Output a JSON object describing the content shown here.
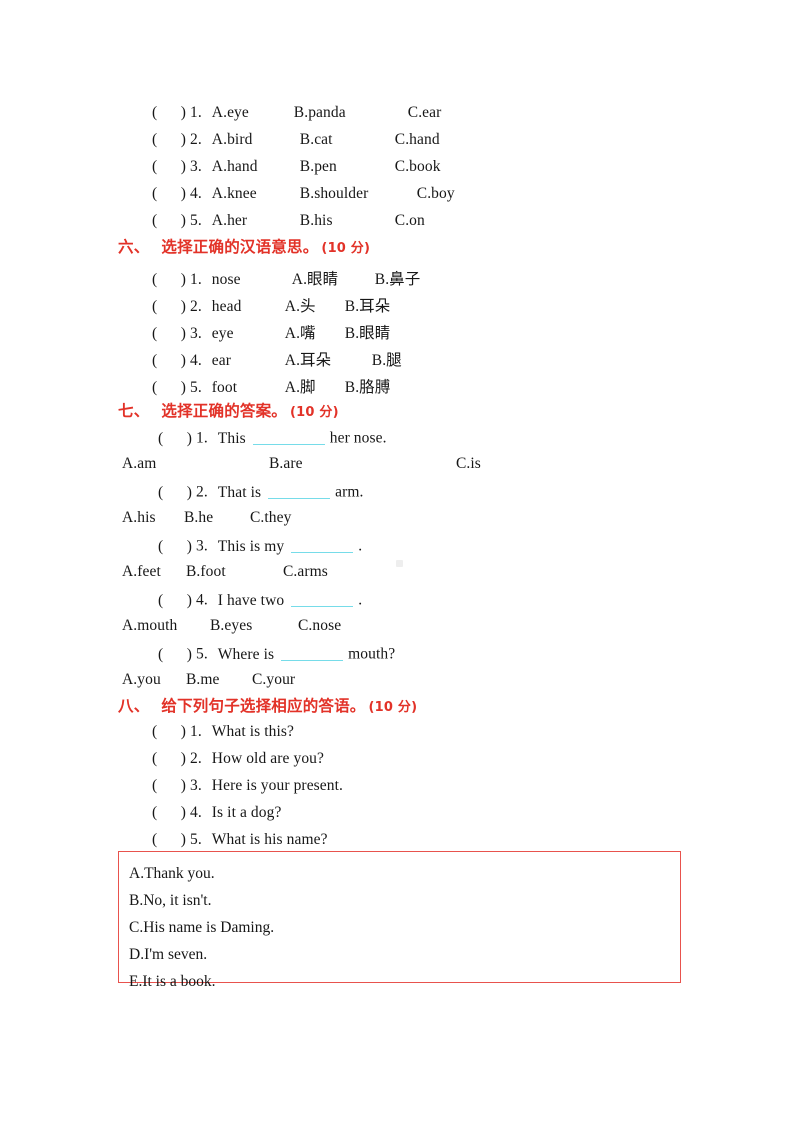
{
  "page": {
    "background": "#ffffff",
    "heading_color": "#e23228",
    "blank_color": "#76dce9",
    "box_border_color": "#e8524d",
    "text_color": "#171717"
  },
  "section_five_tail": {
    "items": [
      {
        "bracket": "",
        "number": "1.",
        "a": "A.eye",
        "b": "B.panda",
        "c": "C.ear"
      },
      {
        "bracket": "",
        "number": "2.",
        "a": "A.bird",
        "b": "B.cat",
        "c": "C.hand"
      },
      {
        "bracket": "",
        "number": "3.",
        "a": "A.hand",
        "b": "B.pen",
        "c": "C.book"
      },
      {
        "bracket": "",
        "number": "4.",
        "a": "A.knee",
        "b": "B.shoulder",
        "c": "C.boy"
      },
      {
        "bracket": "",
        "number": "5.",
        "a": "A.her",
        "b": "B.his",
        "c": "C.on"
      }
    ]
  },
  "section_six": {
    "number": "六、",
    "title": "选择正确的汉语意思。",
    "score": "(10 分)",
    "items": [
      {
        "number": "1.",
        "word": "nose",
        "a": "A.眼睛",
        "b": "B.鼻子"
      },
      {
        "number": "2.",
        "word": "head",
        "a": "A.头",
        "b": "B.耳朵"
      },
      {
        "number": "3.",
        "word": "eye",
        "a": "A.嘴",
        "b": "B.眼睛"
      },
      {
        "number": "4.",
        "word": "ear",
        "a": "A.耳朵",
        "b": "B.腿"
      },
      {
        "number": "5.",
        "word": "foot",
        "a": "A.脚",
        "b": "B.胳膊"
      }
    ]
  },
  "section_seven": {
    "number": "七、",
    "title": "选择正确的答案。",
    "score": "(10 分)",
    "items": [
      {
        "number": "1.",
        "pre": "This",
        "post": "her nose.",
        "options": [
          "A.am",
          "B.are",
          "C.is"
        ]
      },
      {
        "number": "2.",
        "pre": "That is",
        "post": "arm.",
        "options": [
          "A.his",
          "B.he",
          "C.they"
        ]
      },
      {
        "number": "3.",
        "pre": "This is my",
        "post": ".",
        "options": [
          "A.feet",
          "B.foot",
          "C.arms"
        ]
      },
      {
        "number": "4.",
        "pre": "I have two",
        "post": ".",
        "options": [
          "A.mouth",
          "B.eyes",
          "C.nose"
        ]
      },
      {
        "number": "5.",
        "pre": "Where is",
        "post": "mouth?",
        "options": [
          "A.you",
          "B.me",
          "C.your"
        ]
      }
    ]
  },
  "section_eight": {
    "number": "八、",
    "title": "给下列句子选择相应的答语。",
    "score": "(10 分)",
    "questions": [
      {
        "number": "1.",
        "text": "What is this?"
      },
      {
        "number": "2.",
        "text": "How old are you?"
      },
      {
        "number": "3.",
        "text": "Here is your present."
      },
      {
        "number": "4.",
        "text": "Is it a dog?"
      },
      {
        "number": "5.",
        "text": "What is his name?"
      }
    ],
    "answer_bank": [
      "A.Thank you.",
      "B.No, it isn't.",
      "C.His name is Daming.",
      "D.I'm seven.",
      "E.It is a book."
    ]
  }
}
